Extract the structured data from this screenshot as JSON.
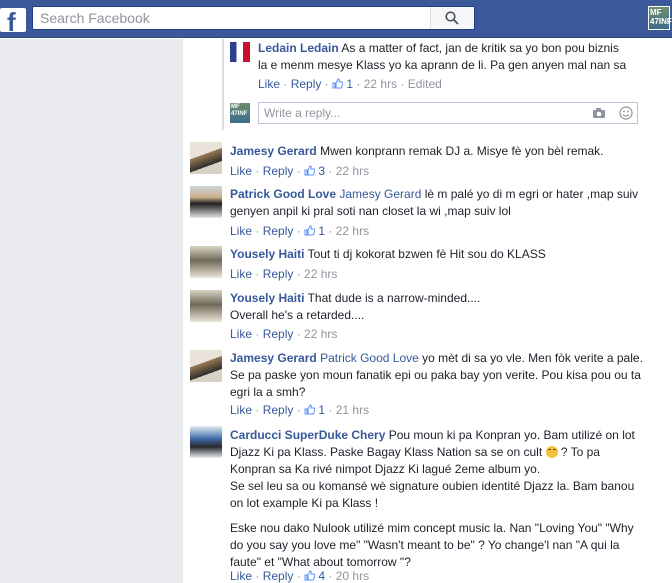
{
  "search": {
    "placeholder": "Search Facebook"
  },
  "top_avatar_text": "MF 47INF",
  "reply": {
    "author": "Ledain Ledain",
    "line1": " As a matter of fact, jan de kritik sa yo bon pou biznis",
    "line2": "la e menm mesye Klass yo ka aprann de li. Pa gen anyen mal nan sa",
    "like": "Like",
    "reply": "Reply",
    "count": "1",
    "time": "22 hrs",
    "edited": "Edited"
  },
  "composer": {
    "avatar_text": "MF 47INF",
    "placeholder": "Write a reply..."
  },
  "comments": [
    {
      "author": "Jamesy Gerard",
      "tag": "",
      "lines": [
        " Mwen konprann remak DJ a. Misye fè yon bèl remak."
      ],
      "count": "3",
      "time": "22 hrs"
    },
    {
      "author": "Patrick Good Love",
      "tag": "Jamesy Gerard",
      "lines": [
        " lè m palé yo di m egri or hater ,map suiv",
        "genyen anpil ki pral soti nan closet la wi ,map suiv lol"
      ],
      "count": "1",
      "time": "22 hrs"
    },
    {
      "author": "Yousely Haiti",
      "tag": "",
      "lines": [
        " Tout ti dj kokorat bzwen fè Hit sou do KLASS"
      ],
      "count": "",
      "time": "22 hrs"
    },
    {
      "author": "Yousely Haiti",
      "tag": "",
      "lines": [
        " That dude is a narrow-minded....",
        "Overall he's a retarded...."
      ],
      "count": "",
      "time": "22 hrs"
    },
    {
      "author": "Jamesy Gerard",
      "tag": "Patrick Good Love",
      "lines": [
        " yo mèt di sa yo vle. Men fòk verite a pale.",
        "Se pa paske yon moun fanatik epi ou paka bay yon verite. Pou kisa pou ou ta",
        "egri la a smh?"
      ],
      "count": "1",
      "time": "21 hrs"
    },
    {
      "author": "Carducci SuperDuke Chery",
      "tag": "",
      "lines": [
        " Pou moun ki pa Konpran yo. Bam utilizé on lot",
        "Djazz Ki pa Klass. Paske Bagay Klass Nation sa se on cult",
        " ? To pa",
        "Konpran sa Ka rivé nimpot Djazz Ki lagué 2eme album yo.",
        "Se sel leu sa ou komansé wè signature oubien identité Djazz la. Bam banou",
        "on lot example Ki pa Klass !",
        "Eske nou dako Nulook utilizé mim concept music la. Nan \"Loving You\" \"Why",
        "do you say you love me\" \"Wasn't meant to be\" ? Yo change'l nan \"A qui la",
        "faute\" et \"What about tomorrow \"?"
      ],
      "count": "4",
      "time": "20 hrs"
    }
  ],
  "labels": {
    "like": "Like",
    "reply": "Reply"
  }
}
